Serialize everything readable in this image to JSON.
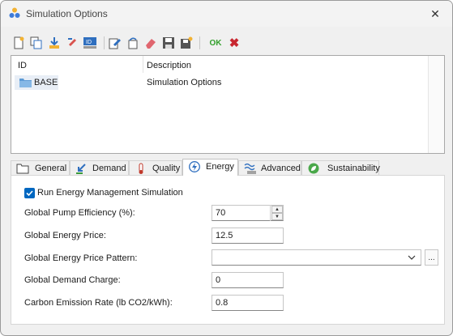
{
  "window": {
    "title": "Simulation Options",
    "close_glyph": "✕"
  },
  "toolbar": {
    "buttons": [
      {
        "name": "new-icon"
      },
      {
        "name": "copy-icon"
      },
      {
        "name": "import-icon"
      },
      {
        "name": "rename-icon"
      },
      {
        "name": "id-icon"
      },
      {
        "name": "edit-icon"
      },
      {
        "name": "undo-icon"
      },
      {
        "name": "eraser-icon"
      },
      {
        "name": "save-icon"
      },
      {
        "name": "save-as-icon"
      }
    ],
    "ok_label": "OK",
    "cancel_glyph": "✖"
  },
  "list": {
    "columns": {
      "id": "ID",
      "description": "Simulation Options",
      "description_header": "Description"
    },
    "rows": [
      {
        "id": "BASE",
        "description": "Simulation Options"
      }
    ]
  },
  "tabs": [
    {
      "label": "General",
      "icon": "folder-icon"
    },
    {
      "label": "Demand",
      "icon": "demand-arrow-icon"
    },
    {
      "label": "Quality",
      "icon": "thermometer-icon"
    },
    {
      "label": "Energy",
      "icon": "energy-bolt-icon",
      "active": true
    },
    {
      "label": "Advanced",
      "icon": "advanced-icon"
    },
    {
      "label": "Sustainability",
      "icon": "leaf-icon"
    }
  ],
  "energy": {
    "run_label": "Run Energy Management Simulation",
    "run_checked": true,
    "pump_efficiency_label": "Global Pump Efficiency (%):",
    "pump_efficiency_value": "70",
    "energy_price_label": "Global Energy Price:",
    "energy_price_value": "12.5",
    "price_pattern_label": "Global Energy Price Pattern:",
    "price_pattern_value": "",
    "browse_label": "...",
    "demand_charge_label": "Global Demand Charge:",
    "demand_charge_value": "0",
    "carbon_label": "Carbon Emission Rate (lb CO2/kWh):",
    "carbon_value": "0.8"
  },
  "colors": {
    "accent": "#0067c0",
    "ok": "#33a02c",
    "cancel": "#c8262f"
  }
}
